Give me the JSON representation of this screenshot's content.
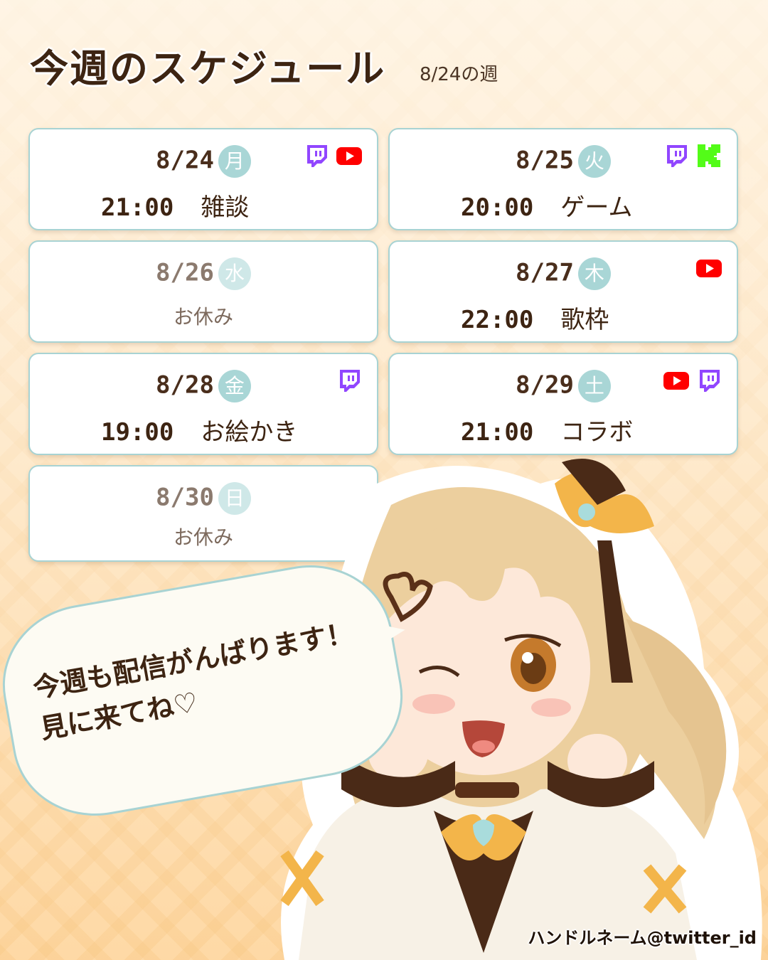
{
  "header": {
    "title": "今週のスケジュール",
    "week": "8/24の週"
  },
  "schedule": [
    {
      "date": "8/24",
      "dow": "月",
      "time": "21:00",
      "event": "雑談",
      "platforms": [
        "twitch-icon",
        "youtube-icon"
      ]
    },
    {
      "date": "8/25",
      "dow": "火",
      "time": "20:00",
      "event": "ゲーム",
      "platforms": [
        "twitch-icon",
        "kick-icon"
      ]
    },
    {
      "date": "8/26",
      "dow": "水",
      "off": "お休み",
      "platforms": []
    },
    {
      "date": "8/27",
      "dow": "木",
      "time": "22:00",
      "event": "歌枠",
      "platforms": [
        "youtube-icon"
      ]
    },
    {
      "date": "8/28",
      "dow": "金",
      "time": "19:00",
      "event": "お絵かき",
      "platforms": [
        "twitch-icon"
      ]
    },
    {
      "date": "8/29",
      "dow": "土",
      "time": "21:00",
      "event": "コラボ",
      "platforms": [
        "youtube-icon",
        "twitch-icon"
      ]
    },
    {
      "date": "8/30",
      "dow": "日",
      "off": "お休み",
      "platforms": []
    }
  ],
  "speech": {
    "line1": "今週も配信がんばります！",
    "line2": "見に来てね♡"
  },
  "footer": {
    "handle": "ハンドルネーム@twitter_id"
  },
  "colors": {
    "twitch": "#9146ff",
    "youtube": "#ff0000",
    "kick": "#53fc18",
    "accent": "#a9d6d6",
    "text": "#3d2412"
  }
}
